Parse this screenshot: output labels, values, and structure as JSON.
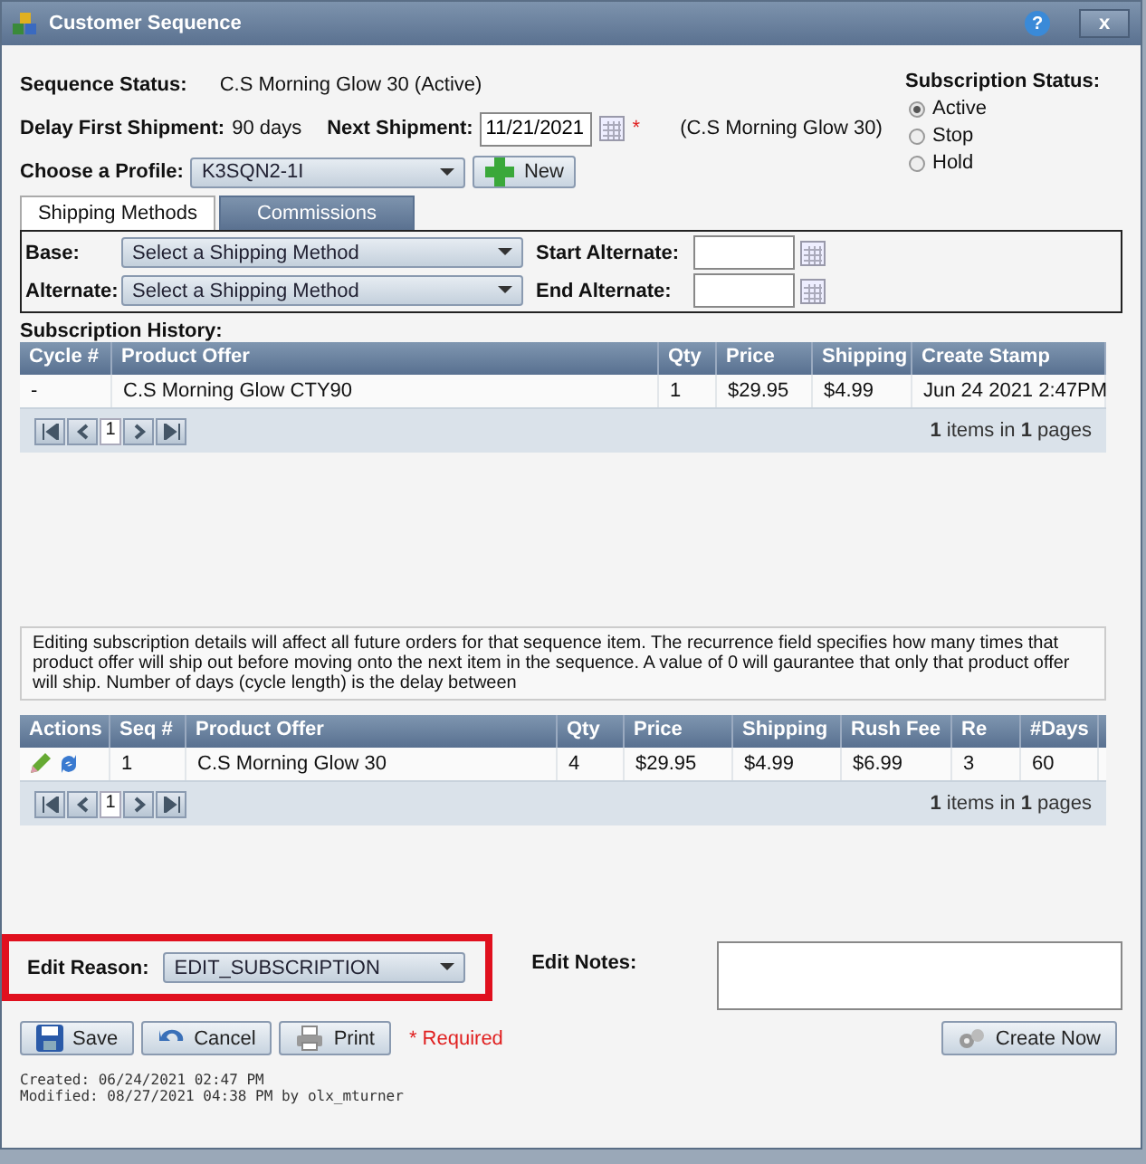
{
  "window": {
    "title": "Customer Sequence",
    "help": "?",
    "close": "x"
  },
  "sequence_status": {
    "label": "Sequence Status:",
    "value": "C.S Morning Glow 30  (Active)"
  },
  "delay_first_shipment": {
    "label": "Delay First Shipment:",
    "value": "90 days"
  },
  "next_shipment": {
    "label": "Next Shipment:",
    "value": "11/21/2021",
    "required_mark": "*",
    "note": "(C.S Morning Glow 30)"
  },
  "profile": {
    "label": "Choose a Profile:",
    "value": "K3SQN2-1I",
    "button": "New"
  },
  "subscription_status": {
    "label": "Subscription Status:",
    "options": [
      {
        "label": "Active",
        "selected": true
      },
      {
        "label": "Stop",
        "selected": false
      },
      {
        "label": "Hold",
        "selected": false
      }
    ]
  },
  "tabs": [
    {
      "label": "Shipping Methods",
      "selected": true
    },
    {
      "label": "Commissions",
      "selected": false
    }
  ],
  "shipping": {
    "base": {
      "label": "Base:",
      "placeholder": "Select a Shipping Method"
    },
    "alternate": {
      "label": "Alternate:",
      "placeholder": "Select a Shipping Method"
    },
    "start_alternate": {
      "label": "Start Alternate:"
    },
    "end_alternate": {
      "label": "End Alternate:"
    }
  },
  "history": {
    "title": "Subscription History:",
    "columns": [
      "Cycle #",
      "Product Offer",
      "Qty",
      "Price",
      "Shipping",
      "Create Stamp"
    ],
    "rows": [
      [
        "-",
        "C.S Morning Glow CTY90",
        "1",
        "$29.95",
        "$4.99",
        "Jun 24 2021 2:47PM"
      ]
    ],
    "pager": {
      "page": "1",
      "summary": "**1** items in **1** pages"
    }
  },
  "notice": "Editing subscription details will affect all future orders for that sequence item. The recurrence field specifies how many times that product offer will ship out before moving onto the next item in the sequence. A value of 0 will gaurantee that only that product offer will ship. Number of days (cycle length) is the delay between",
  "sequence": {
    "columns": [
      "Actions",
      "Seq #",
      "Product Offer",
      "Qty",
      "Price",
      "Shipping",
      "Rush Fee",
      "Re",
      "#Days"
    ],
    "rows": [
      [
        "",
        "1",
        "C.S Morning Glow 30",
        "4",
        "$29.95",
        "$4.99",
        "$6.99",
        "3",
        "60"
      ]
    ],
    "pager": {
      "page": "1",
      "summary": "**1** items in **1** pages"
    }
  },
  "edit_reason": {
    "label": "Edit Reason:",
    "value": "EDIT_SUBSCRIPTION",
    "highlighted": true
  },
  "edit_notes": {
    "label": "Edit Notes:"
  },
  "buttons": [
    {
      "label": "Save",
      "kind": "save"
    },
    {
      "label": "Cancel",
      "kind": "cancel"
    },
    {
      "label": "Print",
      "kind": "print"
    }
  ],
  "required_note": "* Required",
  "create_now": "Create Now",
  "footer": {
    "created": "Created: 06/24/2021 02:47 PM",
    "modified": "Modified: 08/27/2021 04:38 PM by olx_mturner"
  }
}
